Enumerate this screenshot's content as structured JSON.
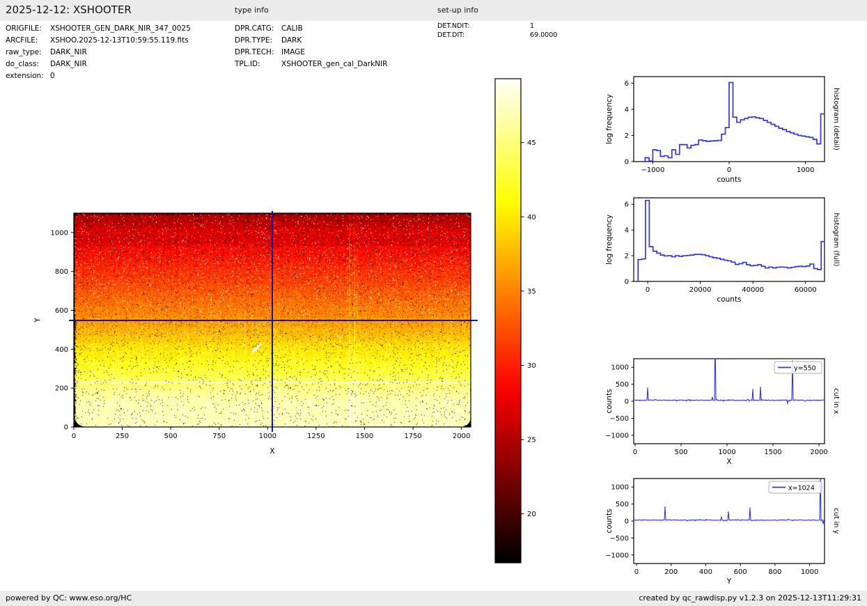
{
  "header": {
    "title": "2025-12-12: XSHOOTER",
    "type_info_label": "type info",
    "setup_info_label": "set-up info"
  },
  "metadata": {
    "file_info": [
      {
        "label": "ORIGFILE:",
        "value": "XSHOOTER_GEN_DARK_NIR_347_0025"
      },
      {
        "label": "ARCFILE:",
        "value": "XSHOO.2025-12-13T10:59:55.119.fits"
      },
      {
        "label": "raw_type:",
        "value": "DARK_NIR"
      },
      {
        "label": "do_class:",
        "value": "DARK_NIR"
      },
      {
        "label": "extension:",
        "value": "0"
      }
    ],
    "type_info": [
      {
        "label": "DPR.CATG:",
        "value": "CALIB"
      },
      {
        "label": "DPR.TYPE:",
        "value": "DARK"
      },
      {
        "label": "DPR.TECH:",
        "value": "IMAGE"
      },
      {
        "label": "TPL.ID:",
        "value": "XSHOOTER_gen_cal_DarkNIR"
      }
    ],
    "setup_info": [
      {
        "label": "DET.NDIT:",
        "value": "1"
      },
      {
        "label": "DET.DIT:",
        "value": "69.0000"
      }
    ]
  },
  "footer": {
    "left": "powered by QC: www.eso.org/HC",
    "right": "created by qc_rawdisp.py v1.2.3 on 2025-12-13T11:29:31"
  },
  "colors": {
    "line_blue": "#3333ee",
    "crosshair_blue": "#1515ad",
    "header_bg": "#ececec",
    "spine": "#000000"
  },
  "chart_data": [
    {
      "type": "heatmap",
      "name": "raw-image-display",
      "xlabel": "X",
      "ylabel": "Y",
      "xlim": [
        0,
        2048
      ],
      "ylim": [
        0,
        1100
      ],
      "xticks": [
        0,
        250,
        500,
        750,
        1000,
        1250,
        1500,
        1750,
        2000
      ],
      "yticks": [
        0,
        200,
        400,
        600,
        800,
        1000
      ],
      "colormap": "hot",
      "colorbar": {
        "ticks": [
          20,
          25,
          30,
          35,
          40,
          45
        ],
        "vmin": 16.7,
        "vmax": 49.3
      },
      "crosshair": {
        "x": 1024,
        "y": 550
      },
      "gradient_profile": [
        [
          0,
          47.5
        ],
        [
          150,
          46.8
        ],
        [
          210,
          45.2
        ],
        [
          235,
          44.2
        ],
        [
          320,
          42.0
        ],
        [
          400,
          40.0
        ],
        [
          480,
          37.8
        ],
        [
          560,
          35.6
        ],
        [
          660,
          33.6
        ],
        [
          780,
          31.2
        ],
        [
          900,
          29.0
        ],
        [
          1000,
          27.2
        ],
        [
          1080,
          24.8
        ],
        [
          1100,
          24.2
        ]
      ],
      "features": {
        "bright_row_y": 230,
        "bright_column_streaks_x": [
          1422,
          1448,
          1461
        ],
        "white_blob_segment": [
          [
            925,
            388
          ],
          [
            962,
            425
          ]
        ],
        "dark_rounded_corners": true,
        "dark_left_edge_below_y": 560
      }
    },
    {
      "type": "histogram",
      "name": "histogram-detail",
      "right_label": "histogram (detail)",
      "xlabel": "counts",
      "ylabel": "log frequency",
      "xlim": [
        -1250,
        1250
      ],
      "ylim": [
        0,
        6.5
      ],
      "xticks": [
        -1000,
        0,
        1000
      ],
      "yticks": [
        0,
        2,
        4,
        6
      ],
      "bin_start": -1250,
      "bin_width": 50,
      "values": [
        0,
        0,
        0,
        0.3,
        0.05,
        0.9,
        0.85,
        0.4,
        0.45,
        0.3,
        0.9,
        0.55,
        1.3,
        1.3,
        1.05,
        1.25,
        1.3,
        1.65,
        1.6,
        1.55,
        1.58,
        1.6,
        1.62,
        2.1,
        2.6,
        6.05,
        3.4,
        3.0,
        3.2,
        3.3,
        3.4,
        3.42,
        3.35,
        3.3,
        3.15,
        3.0,
        2.85,
        2.7,
        2.55,
        2.45,
        2.3,
        2.2,
        2.1,
        2.0,
        1.95,
        1.9,
        1.85,
        1.7,
        1.35,
        3.65
      ]
    },
    {
      "type": "histogram",
      "name": "histogram-full",
      "right_label": "histogram (full)",
      "xlabel": "counts",
      "ylabel": "log frequency",
      "xlim": [
        -5300,
        67200
      ],
      "ylim": [
        0,
        6.5
      ],
      "xticks": [
        0,
        20000,
        40000,
        60000
      ],
      "yticks": [
        0,
        2,
        4,
        6
      ],
      "bin_start": -3650,
      "bin_width": 1420,
      "values": [
        1.7,
        1.75,
        6.3,
        2.7,
        2.35,
        2.2,
        2.05,
        1.98,
        2.0,
        1.92,
        2.0,
        1.95,
        2.0,
        2.02,
        2.05,
        2.1,
        2.1,
        2.08,
        2.0,
        1.92,
        1.85,
        1.8,
        1.72,
        1.65,
        1.6,
        1.5,
        1.32,
        1.38,
        1.48,
        1.3,
        1.22,
        1.25,
        1.3,
        1.18,
        1.05,
        1.12,
        1.05,
        1.1,
        1.12,
        1.1,
        1.05,
        1.1,
        1.15,
        1.18,
        1.15,
        1.2,
        1.35,
        1.0,
        0.92,
        3.1
      ]
    },
    {
      "type": "line",
      "name": "cut-in-x",
      "legend": "y=550",
      "right_label": "cut in x",
      "xlabel": "X",
      "ylabel": "counts",
      "xlim": [
        -15,
        2060
      ],
      "ylim": [
        -1250,
        1250
      ],
      "xticks": [
        0,
        500,
        1000,
        1500,
        2000
      ],
      "yticks": [
        1000,
        500,
        0,
        -500,
        -1000
      ],
      "baseline": 30,
      "noise_amp": 18,
      "spikes": [
        {
          "x": 140,
          "v": 400
        },
        {
          "x": 840,
          "v": 125
        },
        {
          "x": 870,
          "v": 2000
        },
        {
          "x": 1283,
          "v": 360
        },
        {
          "x": 1360,
          "v": 430
        },
        {
          "x": 1660,
          "v": -80
        },
        {
          "x": 1712,
          "v": 1200
        }
      ]
    },
    {
      "type": "line",
      "name": "cut-in-y",
      "legend": "x=1024",
      "right_label": "cut in y",
      "xlabel": "Y",
      "ylabel": "counts",
      "xlim": [
        -16,
        1086
      ],
      "ylim": [
        -1250,
        1250
      ],
      "xticks": [
        0,
        200,
        400,
        600,
        800,
        1000
      ],
      "yticks": [
        1000,
        500,
        0,
        -500,
        -1000
      ],
      "baseline": 28,
      "noise_amp": 16,
      "spikes": [
        {
          "x": 165,
          "v": 430
        },
        {
          "x": 490,
          "v": 130
        },
        {
          "x": 532,
          "v": 280
        },
        {
          "x": 655,
          "v": 400
        },
        {
          "x": 1063,
          "v": 1500
        },
        {
          "x": 1076,
          "v": -90
        }
      ]
    }
  ]
}
